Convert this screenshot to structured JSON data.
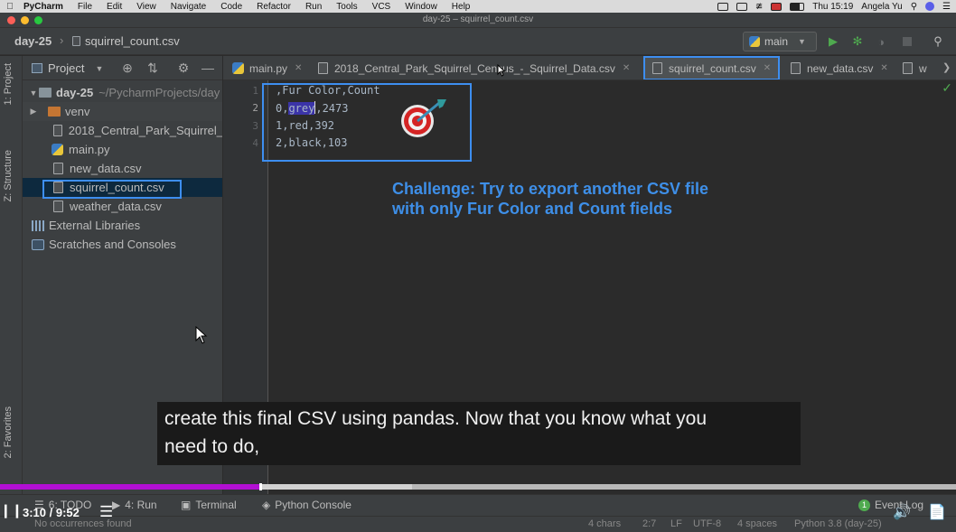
{
  "menubar": {
    "app_name": "PyCharm",
    "items": [
      "File",
      "Edit",
      "View",
      "Navigate",
      "Code",
      "Refactor",
      "Run",
      "Tools",
      "VCS",
      "Window",
      "Help"
    ],
    "clock": "Thu 15:19",
    "user": "Angela Yu"
  },
  "window": {
    "title": "day-25 – squirrel_count.csv"
  },
  "navbar": {
    "project": "day-25",
    "file": "squirrel_count.csv",
    "run_config": "main"
  },
  "left_stripe": {
    "project_tab": "1: Project",
    "structure_tab": "Z: Structure",
    "favorites_tab": "2: Favorites"
  },
  "project_panel": {
    "title": "Project",
    "root": {
      "name": "day-25",
      "path": "~/PycharmProjects/day"
    },
    "items": [
      {
        "label": "venv",
        "kind": "folder"
      },
      {
        "label": "2018_Central_Park_Squirrel_",
        "kind": "csv"
      },
      {
        "label": "main.py",
        "kind": "py"
      },
      {
        "label": "new_data.csv",
        "kind": "csv"
      },
      {
        "label": "squirrel_count.csv",
        "kind": "csv"
      },
      {
        "label": "weather_data.csv",
        "kind": "csv"
      }
    ],
    "external_libraries": "External Libraries",
    "scratches": "Scratches and Consoles"
  },
  "tabs": [
    {
      "label": "main.py",
      "kind": "py"
    },
    {
      "label": "2018_Central_Park_Squirrel_Census_-_Squirrel_Data.csv",
      "kind": "csv"
    },
    {
      "label": "squirrel_count.csv",
      "kind": "csv",
      "active": true
    },
    {
      "label": "new_data.csv",
      "kind": "csv"
    },
    {
      "label": "w",
      "kind": "csv"
    }
  ],
  "editor": {
    "line_numbers": [
      "1",
      "2",
      "3",
      "4"
    ],
    "lines": {
      "l1": ",Fur Color,Count",
      "l2_pre": "0,",
      "l2_sel": "grey",
      "l2_post": ",2473",
      "l3": "1,red,392",
      "l4": "2,black,103"
    },
    "challenge_line1": "Challenge: Try to export another CSV file",
    "challenge_line2": "with only Fur Color and Count fields"
  },
  "subtitle": {
    "line1": "create this final CSV using pandas. Now that you know what you",
    "line2": "need to do,"
  },
  "bottombar": {
    "todo": "6: TODO",
    "run": "4: Run",
    "terminal": "Terminal",
    "python_console": "Python Console",
    "event_log": "Event Log",
    "event_count": "1"
  },
  "statusbar": {
    "message": "No occurrences found",
    "chars": "4 chars",
    "position": "2:7",
    "line_sep": "LF",
    "encoding": "UTF-8",
    "indent": "4 spaces",
    "interpreter": "Python 3.8 (day-25)"
  },
  "video": {
    "time": "3:10 / 9:52",
    "played_fraction": 0.271,
    "buffered_fraction": 0.431
  },
  "colors": {
    "accent": "#3e8fe8",
    "progress": "#b20fd3",
    "selection": "#3b34a8"
  }
}
